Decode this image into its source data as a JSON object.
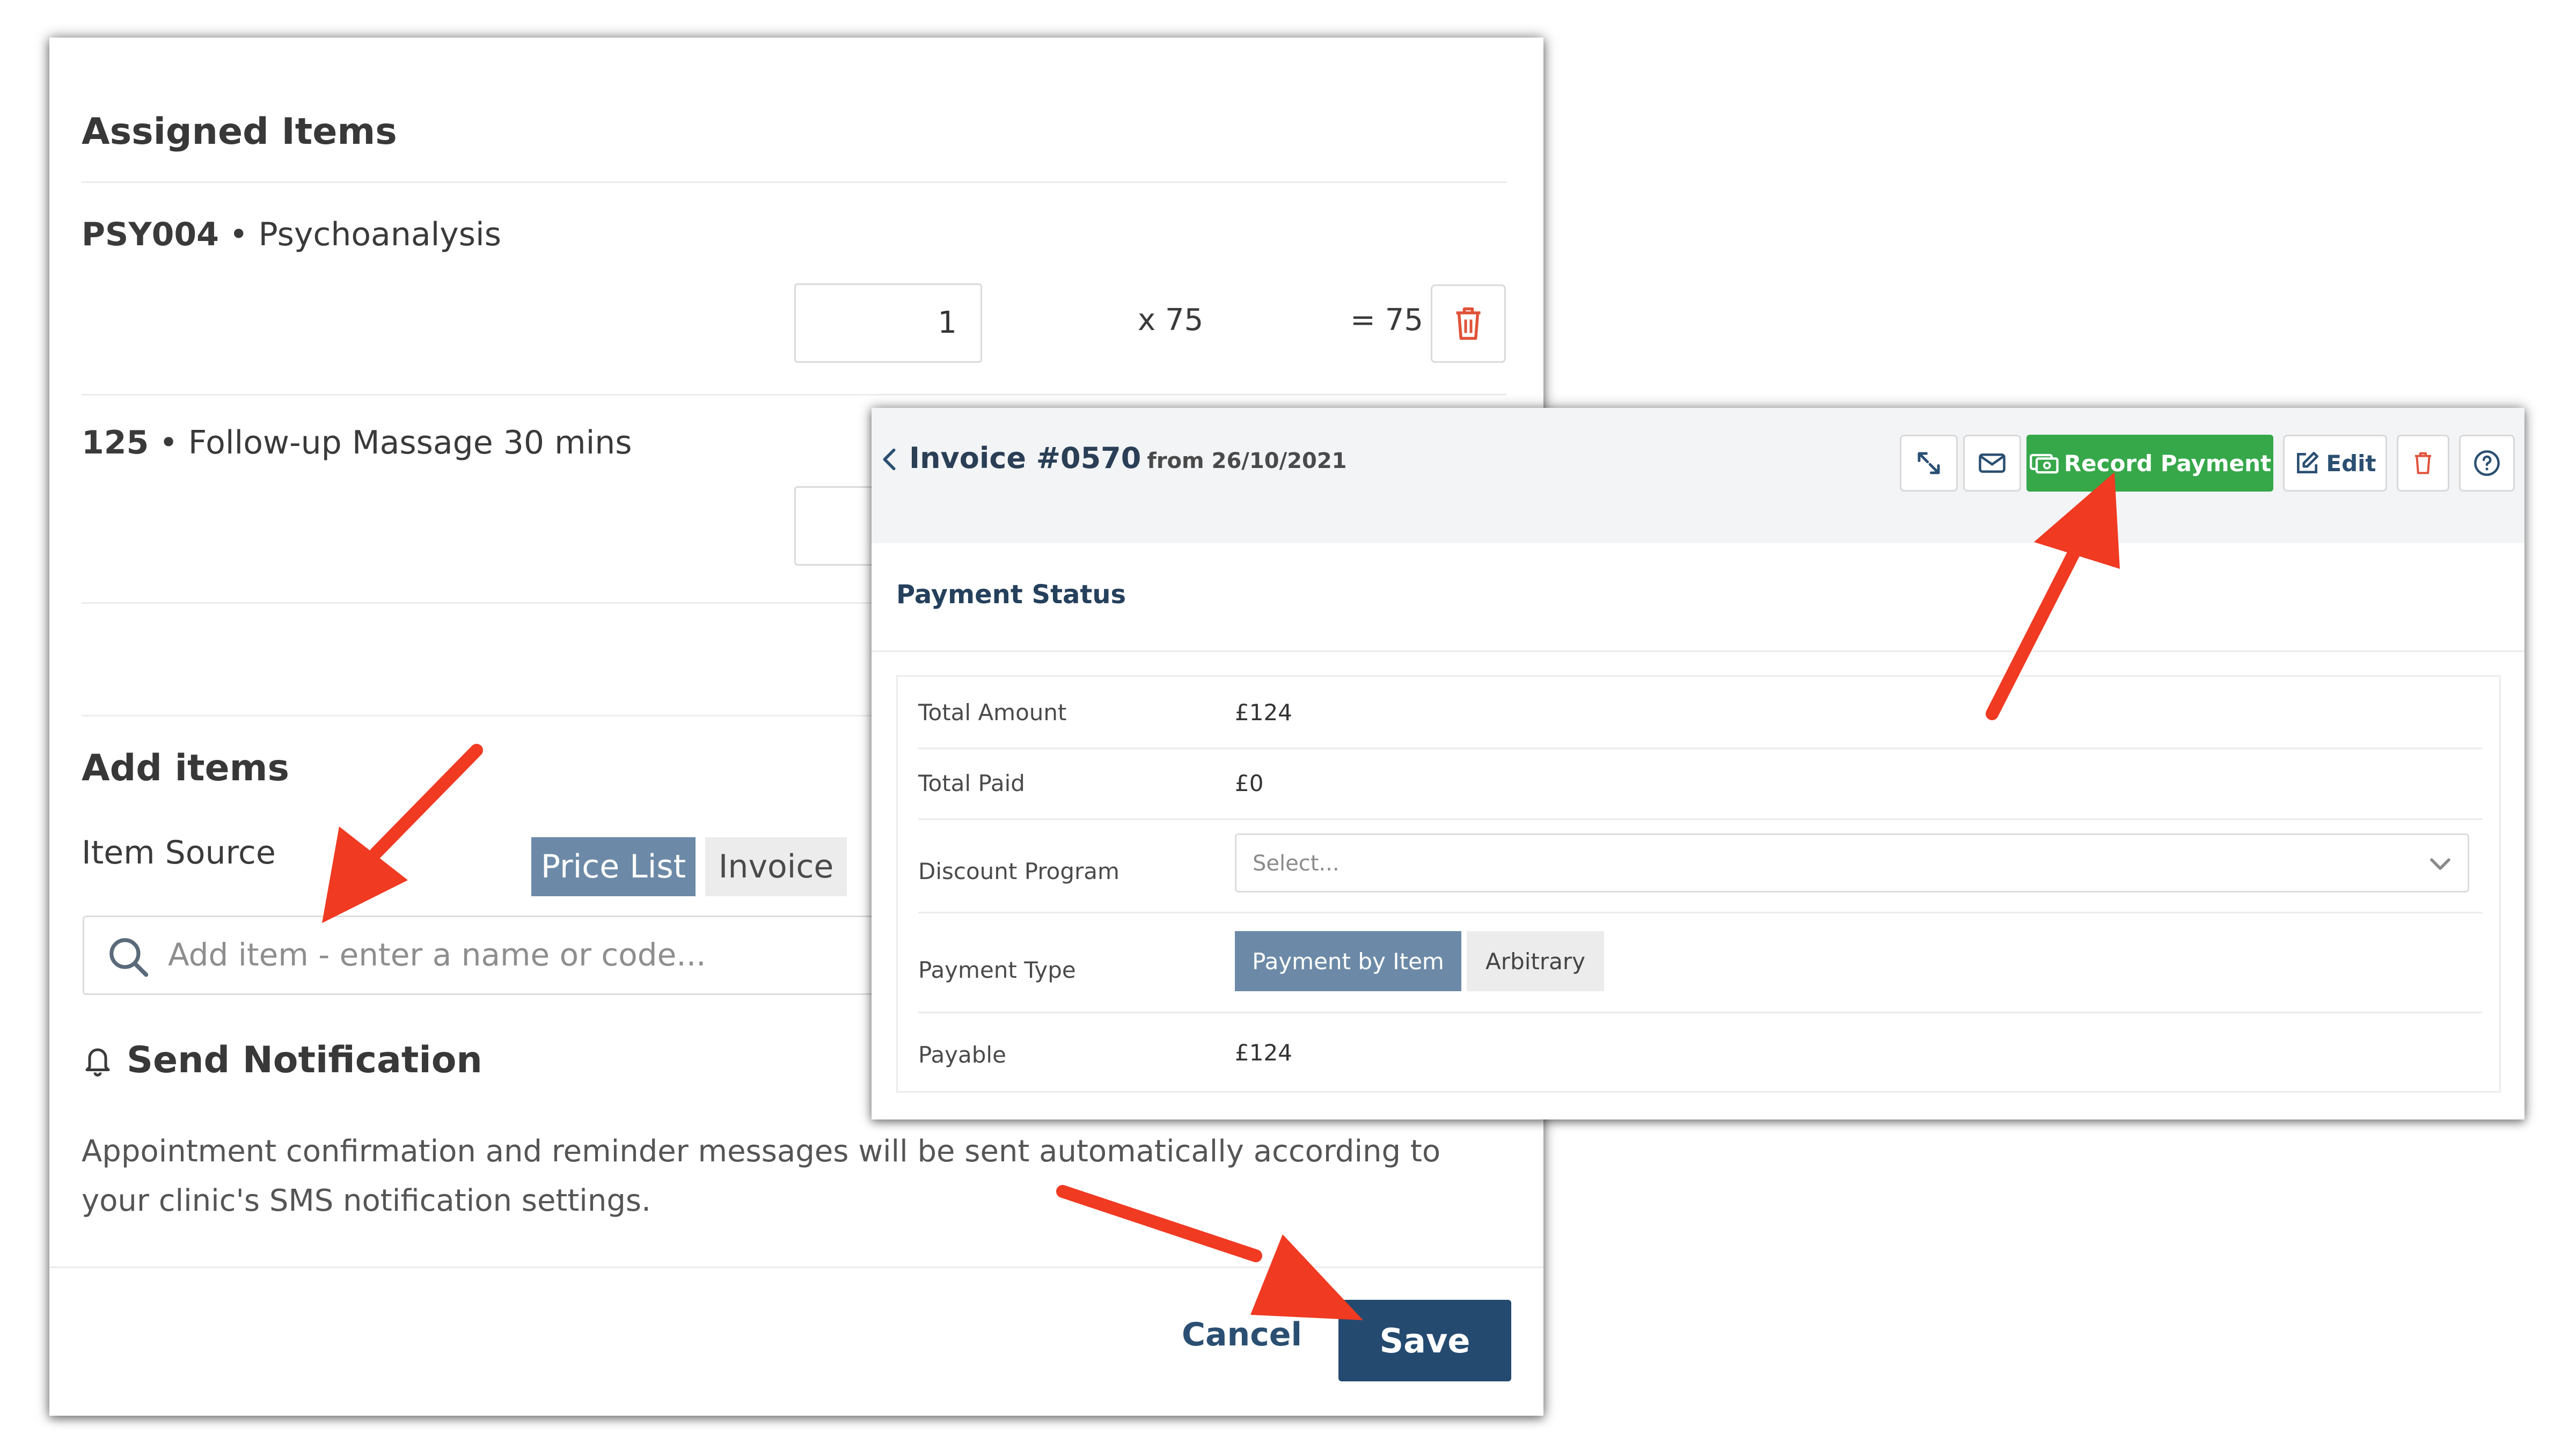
{
  "form": {
    "assigned_title": "Assigned Items",
    "items": [
      {
        "code": "PSY004",
        "separator": " • ",
        "name": "Psychoanalysis",
        "quantity": "1",
        "multiplier": "x 75",
        "total": "= 75"
      },
      {
        "code": "125",
        "separator": " • ",
        "name": "Follow-up Massage 30 mins"
      }
    ],
    "add_title": "Add items",
    "item_source_label": "Item Source",
    "source_options": [
      "Price List",
      "Invoice"
    ],
    "search_placeholder": "Add item - enter a name or code...",
    "notification_title": "Send Notification",
    "notification_text_line1": "Appointment confirmation and reminder messages will be sent automatically according to",
    "notification_text_line2": "your clinic's SMS notification settings.",
    "cancel_label": "Cancel",
    "save_label": "Save"
  },
  "invoice": {
    "title": "Invoice #0570",
    "date_text": "from 26/10/2021",
    "record_payment_label": "Record Payment",
    "edit_label": "Edit",
    "section_title": "Payment Status",
    "total_amount_label": "Total Amount",
    "total_amount_value": "£124",
    "total_paid_label": "Total Paid",
    "total_paid_value": "£0",
    "discount_label": "Discount Program",
    "discount_placeholder": "Select...",
    "payment_type_label": "Payment Type",
    "payment_type_options": [
      "Payment by Item",
      "Arbitrary"
    ],
    "payable_label": "Payable",
    "payable_value": "£124"
  },
  "colors": {
    "save_bg": "#254a70",
    "record_payment_bg": "#36a84a",
    "segment_active": "#6c8aa7",
    "arrow": "#f03a22",
    "delete_red": "#e0533a",
    "link_blue": "#2b4f72"
  },
  "icons": [
    "chevron-left-icon",
    "expand-icon",
    "mail-icon",
    "money-icon",
    "edit-icon",
    "trash-icon",
    "help-icon",
    "search-icon",
    "bell-icon",
    "chevron-down-icon"
  ]
}
